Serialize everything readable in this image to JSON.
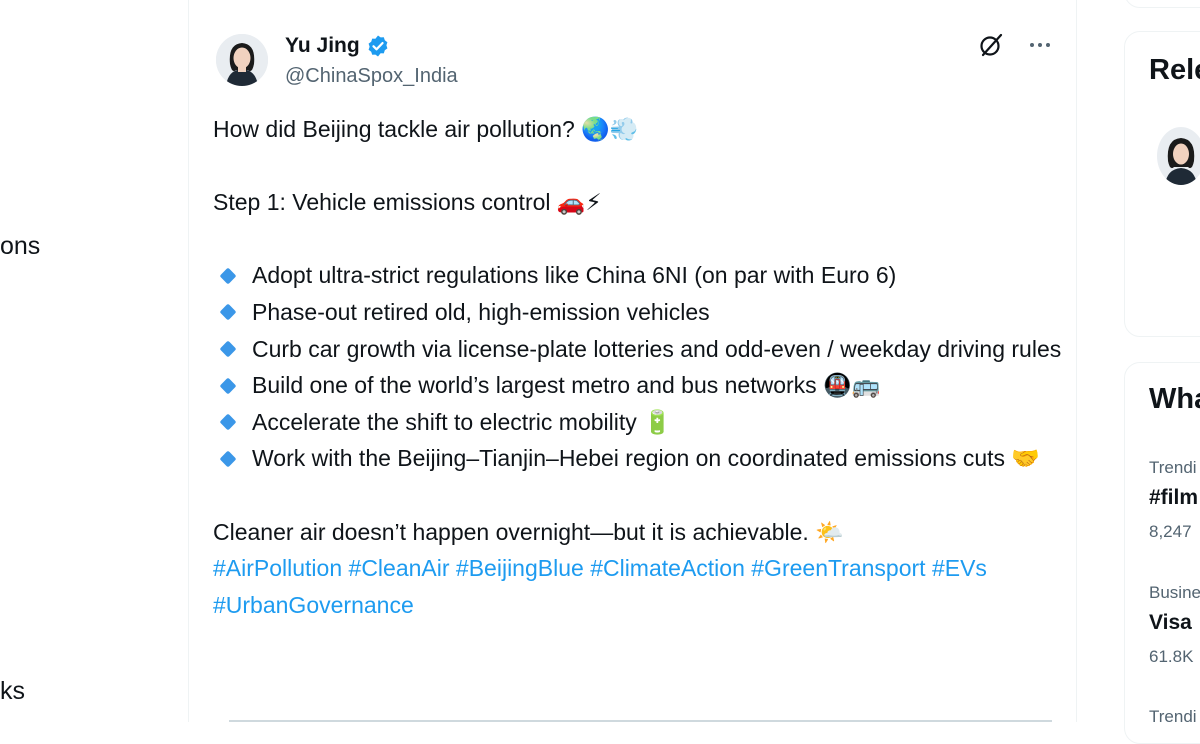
{
  "left_nav": {
    "items": [
      {
        "label": "ons"
      },
      {
        "label": "ks"
      }
    ]
  },
  "post": {
    "author": {
      "display_name": "Yu Jing",
      "handle": "@ChinaSpox_India",
      "verified": true
    },
    "actions": {
      "grok_icon": "grok-icon",
      "more_icon": "more-icon"
    },
    "intro": "How did Beijing tackle air pollution? 🌏💨",
    "step_heading": "Step 1: Vehicle emissions control 🚗⚡",
    "bullets": [
      "Adopt ultra-strict regulations like China 6NI (on par with Euro 6)",
      "Phase-out retired old, high-emission vehicles",
      "Curb car growth via license-plate lotteries and odd-even / weekday driving rules",
      "Build one of the world’s largest metro and bus networks 🚇🚌",
      "Accelerate the shift to electric mobility 🔋",
      "Work with the Beijing–Tianjin–Hebei region on coordinated emissions cuts 🤝"
    ],
    "closing": "Cleaner air doesn’t happen overnight—but it is achievable. 🌤️",
    "hashtags": [
      "#AirPollution",
      "#CleanAir",
      "#BeijingBlue",
      "#ClimateAction",
      "#GreenTransport",
      "#EVs",
      "#UrbanGovernance"
    ]
  },
  "sidebar": {
    "relevant_title": "Rele",
    "whats_title": "Wha",
    "trends": [
      {
        "meta": "Trendi",
        "name": "#film",
        "count": "8,247"
      },
      {
        "meta": "Busine",
        "name": "Visa",
        "count": "61.8K"
      },
      {
        "meta": "Trendi",
        "name": "",
        "count": ""
      }
    ]
  },
  "colors": {
    "accent": "#1d9bf0",
    "bullet_diamond": "#3b97e8",
    "verified_badge": "#1d9bf0",
    "secondary_text": "#536471"
  }
}
